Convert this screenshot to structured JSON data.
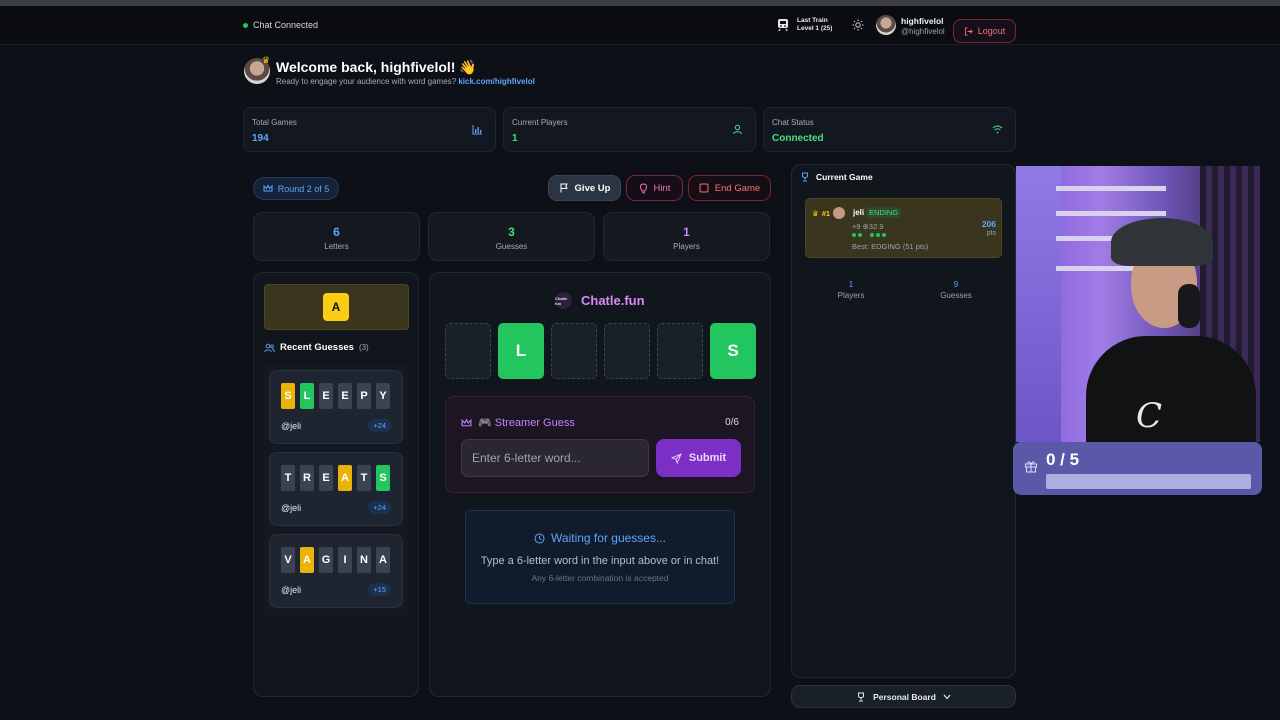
{
  "topbar": {
    "chat_connected": "Chat Connected",
    "last_train_line1": "Last Train",
    "last_train_line2": "Level 1  (25)",
    "username": "highfivelol",
    "handle": "@highfivelol",
    "logout_label": "Logout"
  },
  "welcome": {
    "title": "Welcome back, highfivelol! 👋",
    "subtitle": "Ready to engage your audience with word games?",
    "link": "kick.com/highfivelol"
  },
  "stats": [
    {
      "label": "Total Games",
      "value": "194",
      "color": "#60a5fa",
      "icon": "bar-chart-icon"
    },
    {
      "label": "Current Players",
      "value": "1",
      "color": "#4ade80",
      "icon": "user-icon"
    },
    {
      "label": "Chat Status",
      "value": "Connected",
      "color": "#4ade80",
      "icon": "wifi-icon"
    }
  ],
  "controls": {
    "round": "Round 2 of 5",
    "give_up": "Give Up",
    "hint": "Hint",
    "end_game": "End Game"
  },
  "mini_stats": [
    {
      "num": "6",
      "cap": "Letters",
      "color": "#60a5fa"
    },
    {
      "num": "3",
      "cap": "Guesses",
      "color": "#4ade80"
    },
    {
      "num": "1",
      "cap": "Players",
      "color": "#c084fc"
    }
  ],
  "known_letter": "A",
  "recent": {
    "heading": "Recent Guesses",
    "count": "(3)",
    "guesses": [
      {
        "letters": [
          "S",
          "L",
          "E",
          "E",
          "P",
          "Y"
        ],
        "states": [
          "y",
          "g",
          "n",
          "n",
          "n",
          "n"
        ],
        "user": "@jeli",
        "pts": "+24"
      },
      {
        "letters": [
          "T",
          "R",
          "E",
          "A",
          "T",
          "S"
        ],
        "states": [
          "n",
          "n",
          "n",
          "y",
          "n",
          "g"
        ],
        "user": "@jeli",
        "pts": "+24"
      },
      {
        "letters": [
          "V",
          "A",
          "G",
          "I",
          "N",
          "A"
        ],
        "states": [
          "n",
          "y",
          "n",
          "n",
          "n",
          "n"
        ],
        "user": "@jeli",
        "pts": "+15"
      }
    ]
  },
  "board": {
    "brand": "Chatle.fun",
    "brand_logo_text": "Chatle fun",
    "slots": [
      "",
      "L",
      "",
      "",
      "",
      "S"
    ]
  },
  "streamer": {
    "title": "🎮 Streamer Guess",
    "count": "0/6",
    "placeholder": "Enter 6-letter word...",
    "submit": "Submit"
  },
  "waiting": {
    "title": "Waiting for guesses...",
    "subtitle": "Type a 6-letter word in the input above or in chat!",
    "note": "Any 6-letter combination is accepted"
  },
  "current_game": {
    "heading": "Current Game",
    "rank": "#1",
    "player": "jeli",
    "status": "ENDING",
    "stats": "+9 ⊕32.9",
    "best": "Best: EDGING (51 pts)",
    "points": "206",
    "points_label": "pts",
    "players_num": "1",
    "players_label": "Players",
    "guesses_num": "9",
    "guesses_label": "Guesses"
  },
  "personal_board": "Personal Board",
  "goal": {
    "text": "0 / 5",
    "progress": 0
  }
}
